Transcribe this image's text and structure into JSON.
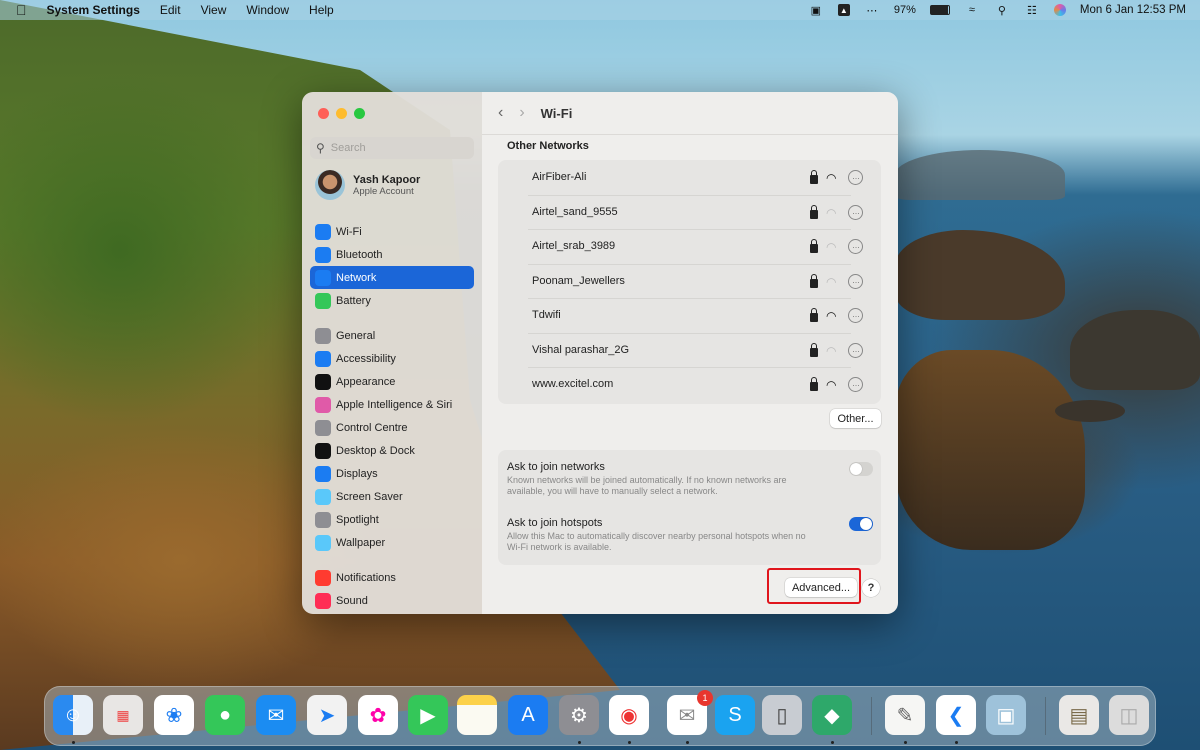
{
  "menubar": {
    "apple": "",
    "app_name": "System Settings",
    "menus": [
      "Edit",
      "View",
      "Window",
      "Help"
    ],
    "battery": "97%",
    "clock": "Mon 6 Jan  12:53 PM",
    "status_icons": [
      "screenshot-icon",
      "vpn-icon",
      "dots-icon",
      "battery-icon",
      "wifi-icon",
      "spotlight-icon",
      "control-centre-icon",
      "siri-icon"
    ]
  },
  "sidebar": {
    "search_placeholder": "Search",
    "account": {
      "name": "Yash Kapoor",
      "subtitle": "Apple Account"
    },
    "items": [
      {
        "label": "Wi-Fi",
        "icon": "wifi-icon",
        "color": "#1b7cf2"
      },
      {
        "label": "Bluetooth",
        "icon": "bluetooth-icon",
        "color": "#1b7cf2"
      },
      {
        "label": "Network",
        "icon": "globe-icon",
        "color": "#1b7cf2",
        "selected": true
      },
      {
        "label": "Battery",
        "icon": "battery-icon",
        "color": "#34c759"
      },
      {
        "label": "General",
        "icon": "gear-icon",
        "color": "#8e8e93"
      },
      {
        "label": "Accessibility",
        "icon": "accessibility-icon",
        "color": "#1b7cf2"
      },
      {
        "label": "Appearance",
        "icon": "appearance-icon",
        "color": "#111111"
      },
      {
        "label": "Apple Intelligence & Siri",
        "icon": "siri-icon",
        "color": "#e05aa8"
      },
      {
        "label": "Control Centre",
        "icon": "control-centre-icon",
        "color": "#8e8e93"
      },
      {
        "label": "Desktop & Dock",
        "icon": "dock-icon",
        "color": "#111111"
      },
      {
        "label": "Displays",
        "icon": "sun-icon",
        "color": "#1b7cf2"
      },
      {
        "label": "Screen Saver",
        "icon": "screensaver-icon",
        "color": "#5ac8fa"
      },
      {
        "label": "Spotlight",
        "icon": "spotlight-icon",
        "color": "#8e8e93"
      },
      {
        "label": "Wallpaper",
        "icon": "wallpaper-icon",
        "color": "#5ac8fa"
      },
      {
        "label": "Notifications",
        "icon": "bell-icon",
        "color": "#ff3b30"
      },
      {
        "label": "Sound",
        "icon": "speaker-icon",
        "color": "#ff2d55"
      }
    ]
  },
  "main": {
    "title": "Wi-Fi",
    "section_title": "Other Networks",
    "networks": [
      {
        "name": "AirFiber-Ali",
        "locked": true,
        "signal": "strong"
      },
      {
        "name": "Airtel_sand_9555",
        "locked": true,
        "signal": "weak"
      },
      {
        "name": "Airtel_srab_3989",
        "locked": true,
        "signal": "weak"
      },
      {
        "name": "Poonam_Jewellers",
        "locked": true,
        "signal": "weak"
      },
      {
        "name": "Tdwifi",
        "locked": true,
        "signal": "strong"
      },
      {
        "name": "Vishal parashar_2G",
        "locked": true,
        "signal": "weak"
      },
      {
        "name": "www.excitel.com",
        "locked": true,
        "signal": "strong"
      }
    ],
    "other_button": "Other...",
    "options": [
      {
        "title": "Ask to join networks",
        "description": "Known networks will be joined automatically. If no known networks are available, you will have to manually select a network.",
        "enabled": false
      },
      {
        "title": "Ask to join hotspots",
        "description": "Allow this Mac to automatically discover nearby personal hotspots when no Wi-Fi network is available.",
        "enabled": true
      }
    ],
    "advanced_button": "Advanced...",
    "help_button": "?"
  },
  "dock": {
    "apps": [
      {
        "name": "Finder",
        "icon": "finder-icon",
        "running": true
      },
      {
        "name": "Launchpad",
        "icon": "launchpad-icon"
      },
      {
        "name": "Safari",
        "icon": "safari-icon"
      },
      {
        "name": "Messages",
        "icon": "messages-icon"
      },
      {
        "name": "Mail",
        "icon": "mail-icon"
      },
      {
        "name": "Maps",
        "icon": "maps-icon"
      },
      {
        "name": "Photos",
        "icon": "photos-icon"
      },
      {
        "name": "FaceTime",
        "icon": "facetime-icon"
      },
      {
        "name": "Notes",
        "icon": "notes-icon"
      },
      {
        "name": "App Store",
        "icon": "appstore-icon"
      },
      {
        "name": "System Settings",
        "icon": "settings-icon",
        "running": true
      },
      {
        "name": "Chrome",
        "icon": "chrome-icon",
        "running": true
      },
      {
        "name": "Mail Client",
        "icon": "mail-client-icon",
        "running": true,
        "badge": "1"
      },
      {
        "name": "Skype",
        "icon": "skype-icon"
      },
      {
        "name": "iPhone Mirroring",
        "icon": "iphone-icon"
      },
      {
        "name": "App",
        "icon": "green-app-icon",
        "running": true
      },
      {
        "name": "TextEdit",
        "icon": "textedit-icon",
        "running": true
      },
      {
        "name": "VS Code",
        "icon": "vscode-icon",
        "running": true
      },
      {
        "name": "Preview",
        "icon": "preview-icon"
      },
      {
        "name": "Downloads",
        "icon": "folder-stack-icon"
      },
      {
        "name": "Trash",
        "icon": "trash-icon"
      }
    ]
  }
}
